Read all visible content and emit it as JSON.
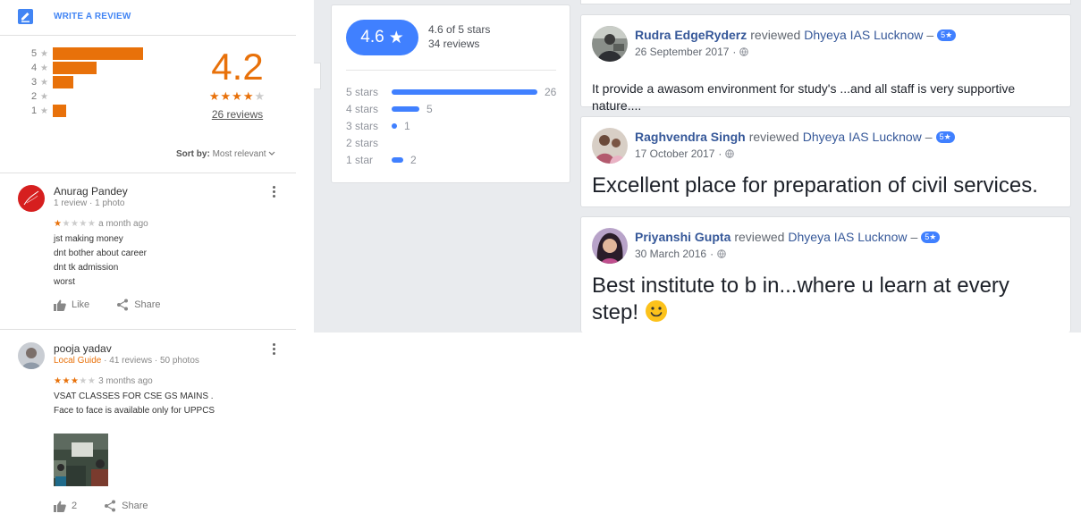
{
  "google": {
    "write_review": "WRITE A REVIEW",
    "histogram": [
      {
        "star": "5",
        "fraction": 0.53
      },
      {
        "star": "4",
        "fraction": 0.26
      },
      {
        "star": "3",
        "fraction": 0.12
      },
      {
        "star": "2",
        "fraction": 0.0
      },
      {
        "star": "1",
        "fraction": 0.08
      }
    ],
    "average": "4.2",
    "average_stars": 4,
    "reviews_count": "26 reviews",
    "sort_label": "Sort by:",
    "sort_value": "Most relevant",
    "reviews": [
      {
        "name": "Anurag Pandey",
        "meta": "1 review · 1 photo",
        "local_guide": "",
        "rating": 1,
        "time": "a month ago",
        "lines": [
          "jst making money",
          "dnt bother about career",
          "dnt tk admission",
          "worst"
        ],
        "like_label": "Like",
        "share_label": "Share"
      },
      {
        "name": "pooja yadav",
        "local_guide": "Local Guide",
        "meta": "· 41 reviews · 50 photos",
        "rating": 3,
        "time": "3 months ago",
        "lines": [
          "VSAT CLASSES FOR CSE GS MAINS .",
          "Face to face is available only for UPPCS"
        ],
        "like_label": "2",
        "share_label": "Share"
      }
    ]
  },
  "facebook": {
    "rating": "4.6",
    "rating_text": "4.6 of 5 stars",
    "reviews_text": "34 reviews",
    "breakdown": [
      {
        "label": "5 stars",
        "count": "26",
        "value": 26
      },
      {
        "label": "4 stars",
        "count": "5",
        "value": 5
      },
      {
        "label": "3 stars",
        "count": "1",
        "value": 1
      },
      {
        "label": "2 stars",
        "count": "",
        "value": 0
      },
      {
        "label": "1 star",
        "count": "2",
        "value": 2
      }
    ],
    "posts": [
      {
        "name": "Rudra EdgeRyderz",
        "verb": "reviewed",
        "page": "Dhyeya IAS Lucknow",
        "dash": "–",
        "badge": "5★",
        "date": "26 September 2017",
        "text": "It provide a awasom environment for study's ...and all staff is very supportive nature...."
      },
      {
        "name": "Raghvendra Singh",
        "verb": "reviewed",
        "page": "Dhyeya IAS Lucknow",
        "dash": "–",
        "badge": "5★",
        "date": "17 October 2017",
        "text": "Excellent place for preparation of civil services."
      },
      {
        "name": "Priyanshi Gupta",
        "verb": "reviewed",
        "page": "Dhyeya IAS Lucknow",
        "dash": "–",
        "badge": "5★",
        "date": "30 March 2016",
        "text": "Best institute to b in...where u learn at every step!"
      }
    ]
  },
  "colors": {
    "google_orange": "#e8710a",
    "google_blue": "#4285f4",
    "fb_blue": "#4080ff",
    "fb_link": "#365899",
    "fb_bg": "#e9ebee"
  },
  "icons": [
    "edit-review-icon",
    "star-icon",
    "more-vert-icon",
    "thumb-up-icon",
    "share-icon",
    "globe-icon",
    "smile-emoji-icon"
  ]
}
